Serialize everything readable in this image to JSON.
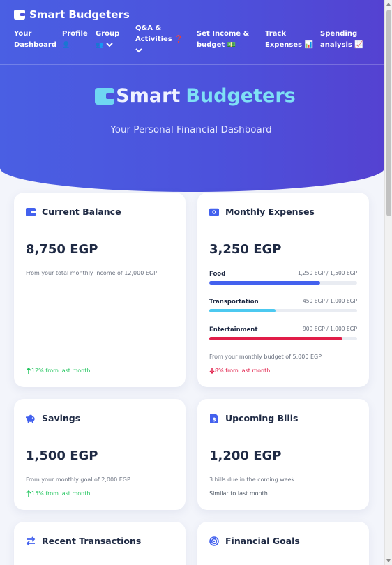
{
  "nav": {
    "brand": "Smart Budgeters",
    "items": [
      {
        "l1": "Your",
        "l2": "Dashboard"
      },
      {
        "l1": "Profile",
        "l2": "👤"
      },
      {
        "l1": "Group",
        "l2": "👥"
      },
      {
        "l1": "Q&A &",
        "l2": "Activities ❓"
      },
      {
        "l1": "Set Income &",
        "l2": "budget 💵"
      },
      {
        "l1": "Track",
        "l2": "Expenses 📊"
      },
      {
        "l1": "Spending",
        "l2": "analysis 📈"
      }
    ]
  },
  "hero": {
    "title_a": "Smart",
    "title_b": "Budgeters",
    "subtitle": "Your Personal Financial Dashboard"
  },
  "cards": {
    "balance": {
      "title": "Current Balance",
      "amount": "8,750 EGP",
      "note": "From your total monthly income of 12,000 EGP",
      "trend": "12% from last month"
    },
    "expenses": {
      "title": "Monthly Expenses",
      "amount": "3,250 EGP",
      "items": [
        {
          "label": "Food",
          "value": "1,250 EGP / 1,500 EGP",
          "progress": 0.75,
          "color": "#4361ee"
        },
        {
          "label": "Transportation",
          "value": "450 EGP / 1,000 EGP",
          "progress": 0.45,
          "color": "#4cc9f0"
        },
        {
          "label": "Entertainment",
          "value": "900 EGP / 1,000 EGP",
          "progress": 0.9,
          "color": "#e11d48"
        }
      ],
      "note": "From your monthly budget of 5,000 EGP",
      "trend": "8% from last month"
    },
    "savings": {
      "title": "Savings",
      "amount": "1,500 EGP",
      "note": "From your monthly goal of 2,000 EGP",
      "trend": "15% from last month"
    },
    "bills": {
      "title": "Upcoming Bills",
      "amount": "1,200 EGP",
      "note": "3 bills due in the coming week",
      "trend": "Similar to last month"
    },
    "transactions": {
      "title": "Recent Transactions"
    },
    "goals": {
      "title": "Financial Goals"
    }
  },
  "colors": {
    "primary": "#4361ee",
    "secondary": "#4cc9f0",
    "success": "#22c55e",
    "danger": "#e11d48"
  }
}
